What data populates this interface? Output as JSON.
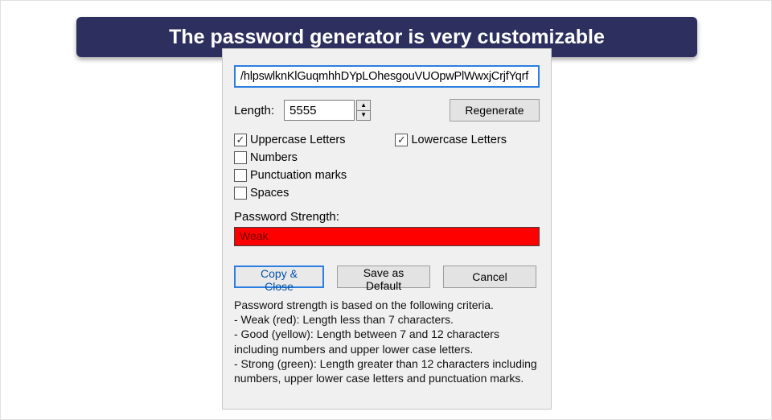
{
  "banner": "The password generator is very customizable",
  "password": "/hlpswlknKlGuqmhhDYpLOhesgouVUOpwPlWwxjCrjfYqrf",
  "length": {
    "label": "Length:",
    "value": "5555"
  },
  "regenerate": "Regenerate",
  "options": {
    "uppercase": {
      "label": "Uppercase Letters",
      "checked": true
    },
    "lowercase": {
      "label": "Lowercase Letters",
      "checked": true
    },
    "numbers": {
      "label": "Numbers",
      "checked": false
    },
    "punctuation": {
      "label": "Punctuation marks",
      "checked": false
    },
    "spaces": {
      "label": "Spaces",
      "checked": false
    }
  },
  "strength": {
    "label": "Password Strength:",
    "value": "Weak",
    "color": "#ff0000"
  },
  "buttons": {
    "copy_close": "Copy & Close",
    "save_default": "Save as Default",
    "cancel": "Cancel"
  },
  "criteria": {
    "intro": "Password strength is based on the following criteria.",
    "weak": "- Weak (red): Length less than 7 characters.",
    "good": "- Good (yellow): Length between 7 and 12 characters including numbers and upper lower case letters.",
    "strong": "- Strong (green): Length greater than 12 characters including numbers, upper lower case letters and punctuation marks."
  }
}
